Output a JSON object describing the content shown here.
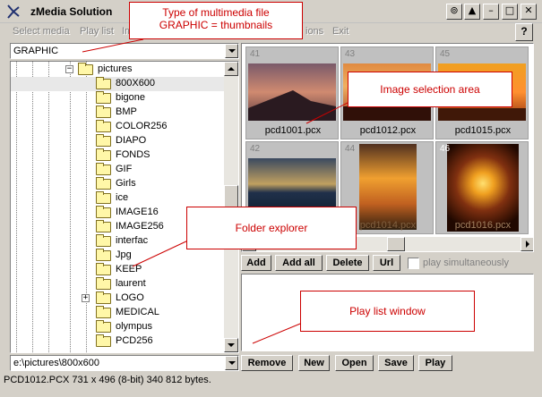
{
  "window": {
    "title": "zMedia Solution"
  },
  "menu": [
    "Select media",
    "Play list",
    "Im",
    "ions",
    "Exit"
  ],
  "help_label": "?",
  "media_type": {
    "value": "GRAPHIC"
  },
  "tree": {
    "parent": "pictures",
    "items": [
      "800X600",
      "bigone",
      "BMP",
      "COLOR256",
      "DIAPO",
      "FONDS",
      "GIF",
      "Girls",
      "ice",
      "IMAGE16",
      "IMAGE256",
      "interfac",
      "Jpg",
      "KEEP",
      "laurent",
      "LOGO",
      "MEDICAL",
      "olympus",
      "PCD256"
    ],
    "selected": "800X600",
    "expandable": "LOGO"
  },
  "path": {
    "value": "e:\\pictures\\800x600"
  },
  "thumbnails": [
    {
      "num": "41",
      "name": "pcd1001.pcx"
    },
    {
      "num": "43",
      "name": "pcd1012.pcx"
    },
    {
      "num": "45",
      "name": "pcd1015.pcx"
    },
    {
      "num": "42",
      "name": ""
    },
    {
      "num": "44",
      "name": "pcd1014.pcx"
    },
    {
      "num": "46",
      "name": "pcd1016.pcx"
    }
  ],
  "image_buttons": {
    "add": "Add",
    "add_all": "Add all",
    "delete": "Delete",
    "url": "Url",
    "play_sim": "play simultaneously"
  },
  "playlist_buttons": {
    "remove": "Remove",
    "new": "New",
    "open": "Open",
    "save": "Save",
    "play": "Play"
  },
  "status": "PCD1012.PCX 731 x 496 (8-bit) 340 812 bytes.",
  "callouts": {
    "type": [
      "Type of multimedia file",
      "GRAPHIC = thumbnails"
    ],
    "image_area": "Image selection area",
    "folder": "Folder explorer",
    "playlist": "Play list window"
  },
  "colors": {
    "callout": "#cc0000",
    "chrome": "#d4d0c8"
  }
}
